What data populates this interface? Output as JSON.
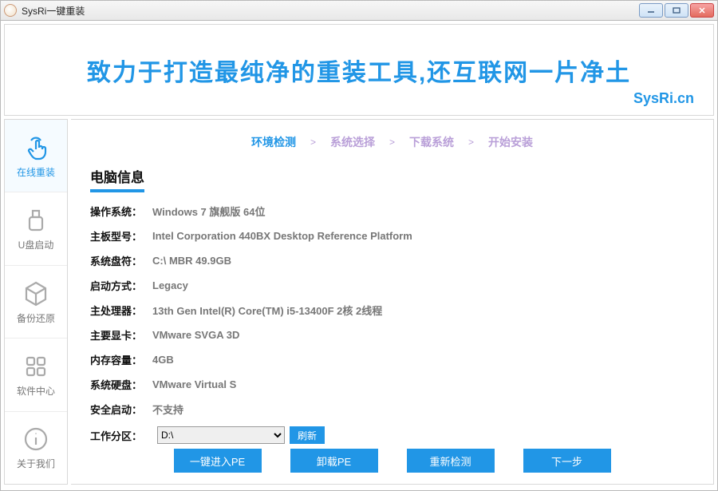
{
  "window": {
    "title": "SysRi一键重装"
  },
  "banner": {
    "headline": "致力于打造最纯净的重装工具,还互联网一片净土",
    "sub": "SysRi.cn"
  },
  "sidebar": {
    "items": [
      {
        "label": "在线重装"
      },
      {
        "label": "U盘启动"
      },
      {
        "label": "备份还原"
      },
      {
        "label": "软件中心"
      },
      {
        "label": "关于我们"
      }
    ]
  },
  "steps": [
    {
      "label": "环境检测",
      "active": true
    },
    {
      "label": "系统选择",
      "active": false
    },
    {
      "label": "下载系统",
      "active": false
    },
    {
      "label": "开始安装",
      "active": false
    }
  ],
  "section_title": "电脑信息",
  "info": {
    "os_label": "操作系统：",
    "os_value": "Windows 7 旗舰版   64位",
    "mb_label": "主板型号：",
    "mb_value": "Intel Corporation 440BX Desktop Reference Platform",
    "disk_label": "系统盘符：",
    "disk_value": "C:\\ MBR 49.9GB",
    "boot_label": "启动方式：",
    "boot_value": "Legacy",
    "cpu_label": "主处理器：",
    "cpu_value": "13th Gen Intel(R) Core(TM) i5-13400F 2核 2线程",
    "gpu_label": "主要显卡：",
    "gpu_value": "VMware SVGA 3D",
    "mem_label": "内存容量：",
    "mem_value": "4GB",
    "hdd_label": "系统硬盘：",
    "hdd_value": "VMware Virtual S",
    "secure_label": "安全启动：",
    "secure_value": "不支持",
    "part_label": "工作分区：",
    "part_value": "D:\\",
    "refresh": "刷新"
  },
  "buttons": {
    "pe_enter": "一键进入PE",
    "pe_unload": "卸载PE",
    "recheck": "重新检测",
    "next": "下一步"
  }
}
